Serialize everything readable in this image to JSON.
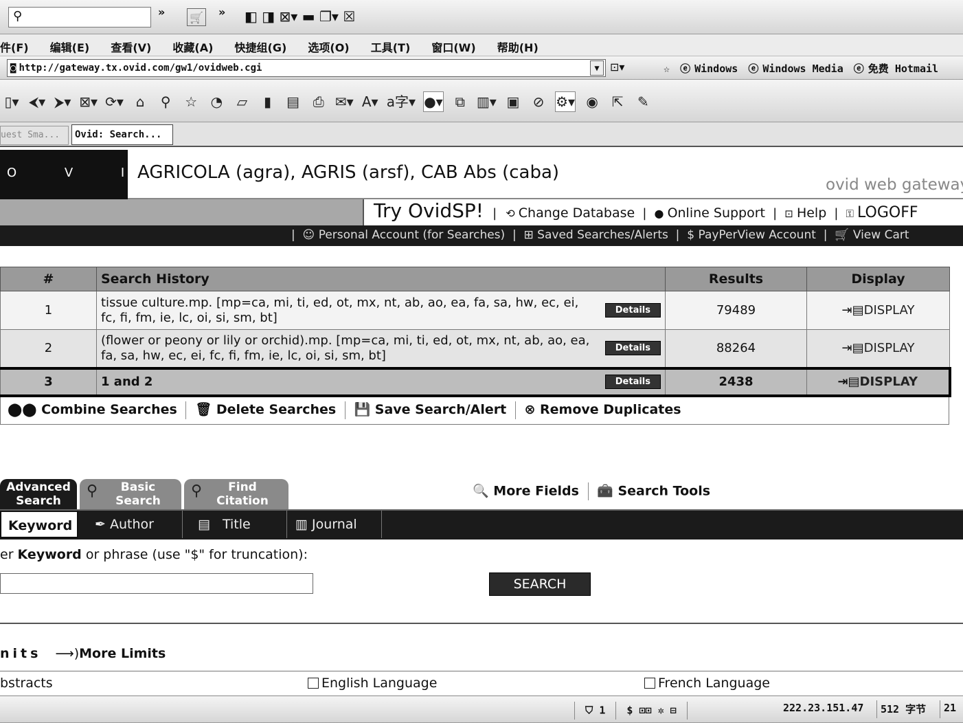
{
  "browser": {
    "menu": [
      "件(F)",
      "编辑(E)",
      "查看(V)",
      "收藏(A)",
      "快捷组(G)",
      "选项(O)",
      "工具(T)",
      "窗口(W)",
      "帮助(H)"
    ],
    "address": "http://gateway.tx.ovid.com/gw1/ovidweb.cgi",
    "links": [
      "Windows",
      "Windows Media",
      "免费 Hotmail"
    ],
    "tabs": [
      "uest Sma...",
      "Ovid: Search..."
    ],
    "status": {
      "count": "1",
      "ip": "222.23.151.47",
      "size": "512 字节",
      "time": "21"
    }
  },
  "header": {
    "logo": "O V I D",
    "db_title": "AGRICOLA (agra), AGRIS (arsf), CAB Abs (caba)",
    "gateway": "ovid web gateway",
    "try": "Try OvidSP!",
    "nav": [
      "Change Database",
      "Online Support",
      "Help",
      "LOGOFF"
    ],
    "subnav": [
      "Personal Account (for Searches)",
      "Saved Searches/Alerts",
      "PayPerView Account",
      "View Cart"
    ]
  },
  "history": {
    "columns": [
      "#",
      "Search History",
      "Results",
      "Display"
    ],
    "rows": [
      {
        "num": "1",
        "query": "tissue culture.mp. [mp=ca, mi, ti, ed, ot, mx, nt, ab, ao, ea, fa, sa, hw, ec, ei, fc, fi, fm, ie, lc, oi, si, sm, bt]",
        "results": "79489"
      },
      {
        "num": "2",
        "query": "(flower or peony or lily or orchid).mp. [mp=ca, mi, ti, ed, ot, mx, nt, ab, ao, ea, fa, sa, hw, ec, ei, fc, fi, fm, ie, lc, oi, si, sm, bt]",
        "results": "88264"
      },
      {
        "num": "3",
        "query": "1 and 2",
        "results": "2438"
      }
    ],
    "details_label": "Details",
    "display_label": "DISPLAY",
    "actions": [
      "Combine Searches",
      "Delete Searches",
      "Save Search/Alert",
      "Remove Duplicates"
    ]
  },
  "search": {
    "tabs": [
      "Advanced Search",
      "Basic Search",
      "Find Citation"
    ],
    "tools": [
      "More Fields",
      "Search Tools"
    ],
    "subtabs": [
      "Keyword",
      "Author",
      "Title",
      "Journal"
    ],
    "prompt_pre": "er ",
    "prompt_bold": "Keyword",
    "prompt_post": " or phrase (use \"$\" for truncation):",
    "input_value": "",
    "button": "SEARCH"
  },
  "limits": {
    "title": "nits",
    "more": "More Limits",
    "options": [
      "bstracts",
      "English Language",
      "French Language"
    ]
  }
}
